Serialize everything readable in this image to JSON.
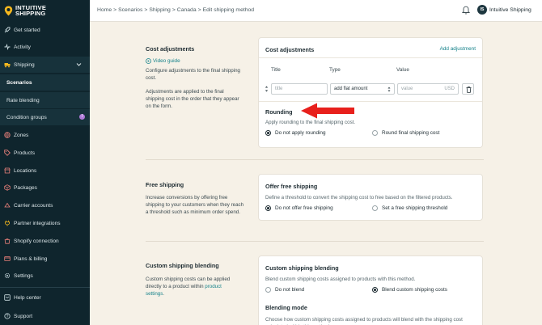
{
  "app": {
    "logo_line1": "INTUITIVE",
    "logo_line2": "SHIPPING"
  },
  "sidebar": {
    "items": [
      {
        "label": "Get started",
        "icon": "rocket-icon"
      },
      {
        "label": "Activity",
        "icon": "activity-icon"
      },
      {
        "label": "Shipping",
        "icon": "truck-icon"
      },
      {
        "label": "Scenarios"
      },
      {
        "label": "Rate blending"
      },
      {
        "label": "Condition groups",
        "badge": "!"
      },
      {
        "label": "Zones",
        "icon": "globe-icon"
      },
      {
        "label": "Products",
        "icon": "tag-icon"
      },
      {
        "label": "Locations",
        "icon": "store-icon"
      },
      {
        "label": "Packages",
        "icon": "box-icon"
      },
      {
        "label": "Carrier accounts",
        "icon": "carrier-icon"
      },
      {
        "label": "Partner integrations",
        "icon": "plug-icon"
      },
      {
        "label": "Shopify connection",
        "icon": "shopify-icon"
      },
      {
        "label": "Plans & billing",
        "icon": "card-icon"
      },
      {
        "label": "Settings",
        "icon": "gear-icon"
      },
      {
        "label": "Help center",
        "icon": "help-icon"
      },
      {
        "label": "Support",
        "icon": "support-icon"
      }
    ]
  },
  "topbar": {
    "breadcrumb": [
      "Home",
      ">",
      "Scenarios",
      ">",
      "Shipping",
      ">",
      "Canada",
      ">",
      "Edit shipping method"
    ],
    "avatar_initials": "IS",
    "account_name": "Intuitive Shipping"
  },
  "cost_adjustments": {
    "section_title": "Cost adjustments",
    "video_link": "Video guide",
    "desc1": "Configure adjustments to the final shipping cost.",
    "desc2": "Adjustments are applied to the final shipping cost in the order that they appear on the form.",
    "card_title": "Cost adjustments",
    "add_link": "Add adjustment",
    "col_title": "Title",
    "col_type": "Type",
    "col_value": "Value",
    "title_placeholder": "title",
    "type_value": "add flat amount",
    "value_placeholder": "value",
    "currency": "USD"
  },
  "rounding": {
    "title": "Rounding",
    "text": "Apply rounding to the final shipping cost.",
    "option1": "Do not apply rounding",
    "option2": "Round final shipping cost"
  },
  "free_shipping": {
    "section_title": "Free shipping",
    "desc": "Increase conversions by offering free shipping to your customers when they reach a threshold such as minimum order spend.",
    "card_title": "Offer free shipping",
    "text": "Define a threshold to convert the shipping cost to free based on the filtered products.",
    "option1": "Do not offer free shipping",
    "option2": "Set a free shipping threshold"
  },
  "custom_blending": {
    "section_title": "Custom shipping blending",
    "desc_prefix": "Custom shipping costs can be applied directly to a product within ",
    "desc_link": "product settings",
    "desc_suffix": ".",
    "card_title": "Custom shipping blending",
    "text": "Blend custom shipping costs assigned to products with this method.",
    "option1": "Do not blend",
    "option2": "Blend custom shipping costs",
    "mode_title": "Blending mode",
    "mode_text": "Choose how custom shipping costs assigned to products will blend with the shipping cost calculated within this method."
  },
  "colors": {
    "sidebar_bg": "#0f252d",
    "page_bg": "#f6f1e7",
    "link": "#16828a",
    "annotation_arrow": "#e8201c"
  }
}
